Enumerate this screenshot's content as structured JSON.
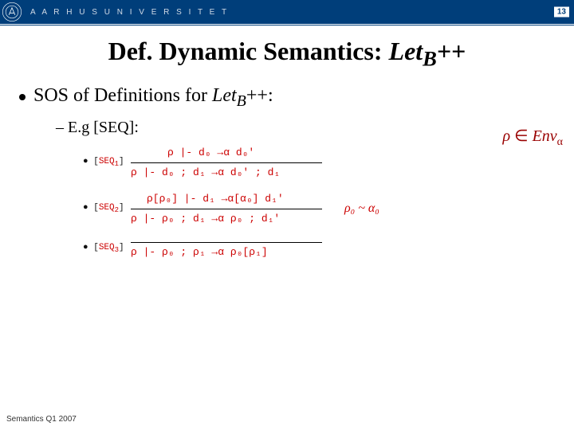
{
  "header": {
    "uni_name": "A A R H U S   U N I V E R S I T E T",
    "slide_num": "13"
  },
  "title": {
    "pre": "Def. Dynamic Semantics: ",
    "name": "Let",
    "sub": "B",
    "post": "++"
  },
  "bullet1": {
    "pre": "SOS of Definitions for ",
    "name": "Let",
    "sub": "B",
    "post": "++:"
  },
  "annotation": {
    "lhs": "ρ",
    "sym": " ∈ ",
    "rhs": "Env",
    "sub": "α"
  },
  "bullet2": "– E.g [SEQ]:",
  "rules": {
    "r1": {
      "label_pre": "● [",
      "label_name": "SEQ",
      "label_sub": "1",
      "label_post": "]",
      "top": "ρ |- d₀  →α  d₀'",
      "bot": "ρ |-  d₀ ; d₁  →α  d₀' ; d₁"
    },
    "r2": {
      "label_pre": "● [",
      "label_name": "SEQ",
      "label_sub": "2",
      "label_post": "]",
      "top": "ρ[ρ₀] |-  d₁  →α[α₀]  d₁'",
      "bot": "ρ |-  ρ₀ ; d₁  →α  ρ₀ ; d₁'",
      "side": "ρ₀ ~ α₀"
    },
    "r3": {
      "label_pre": "● [",
      "label_name": "SEQ",
      "label_sub": "3",
      "label_post": "]",
      "top": "",
      "bot": "ρ |-  ρ₀ ; ρ₁  →α  ρ₀[ρ₁]"
    }
  },
  "footer": "Semantics Q1 2007"
}
